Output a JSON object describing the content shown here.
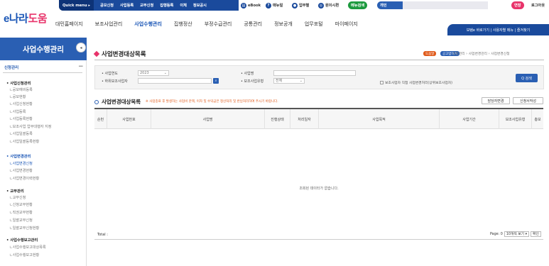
{
  "topbar": {
    "quick_menu": "Quick menu ▸",
    "quick_items": [
      "공모신청",
      "사업등록",
      "교부신청",
      "집행등록",
      "이체",
      "정보공시"
    ],
    "pills": [
      "eBook",
      "매뉴얼",
      "업무별",
      "원이시편",
      "메뉴검색",
      "개인",
      "연장",
      "로그아웃"
    ]
  },
  "logo": {
    "prefix": "e나라",
    "suffix": "도움"
  },
  "gnb": {
    "items": [
      "대민홈페이지",
      "보조사업관리",
      "사업수행관리",
      "집행정산",
      "부정수급관리",
      "공통관리",
      "정보공개",
      "업무포털",
      "마이페이지"
    ],
    "active": "사업수행관리",
    "right_links": "보탬e 바로가기 | 사용자별 메뉴 | 즐겨찾기"
  },
  "sidebar": {
    "title": "사업수행관리",
    "section": "신청관리",
    "collapse_icon": "◂",
    "groups": [
      {
        "label": "• 사업신청관리",
        "items": [
          "ㄴ공모예비등록",
          "ㄴ공모현황",
          "ㄴ사업신청현황",
          "ㄴ사업등록",
          "ㄴ사업등록현황",
          "ㄴ보조사업 업무대행자 지정",
          "ㄴ사업일괄등록",
          "ㄴ사업일괄등록현황"
        ]
      },
      {
        "label": "• 사업변경관리",
        "items": [
          "ㄴ사업변경신청",
          "ㄴ사업변경현황",
          "ㄴ사업변경이력현황"
        ]
      },
      {
        "label": "• 교부관리",
        "items": [
          "ㄴ교부신청",
          "ㄴ신청교부현황",
          "ㄴ직권교부현황",
          "ㄴ일괄교부신청",
          "ㄴ일괄교부신청현황"
        ]
      },
      {
        "label": "• 사업수행보고관리",
        "items": [
          "ㄴ사업수행보고대상목록",
          "ㄴ사업수행보고현황"
        ]
      }
    ]
  },
  "page": {
    "title": "사업변경대상목록",
    "tags": [
      "도움말",
      "공고업하기"
    ],
    "breadcrumb": "신청관리 › 사업변경관리 › 사업변경신청"
  },
  "search": {
    "year_label": "• 사업연도",
    "year_value": "2023",
    "name_label": "• 사업명",
    "name_value": "",
    "org_label": "• 하위보조사업자",
    "org_value": "",
    "type_label": "• 보조사업유형",
    "type_value": "전체",
    "checkbox_label": "보조사업자 직접 사업변경처리(상위보조사업자)",
    "search_button": "Q 검색"
  },
  "list": {
    "title": "사업변경대상목록",
    "note": "※ 사업종료 후 발생하는 사업비 잔액, 이자 및 수익금은 정산처리 및 반납처리하여 주시기 바랍니다.",
    "btn_assignee": "담당자변경",
    "btn_history": "신청서작성",
    "columns": [
      "순번",
      "사업번호",
      "사업명",
      "진행상태",
      "처리일자",
      "사업목적",
      "사업기간",
      "보조사업유형",
      "총보"
    ],
    "empty_text": "조회된 데이터가 없습니다.",
    "total_label": "Total :",
    "page_label": "Page: 0",
    "page_size": "10개씩 보기 ▾",
    "go_button": "확인"
  },
  "colors": {
    "brand_blue": "#1a4a9c",
    "accent_blue": "#2a5fb3",
    "logo_pink": "#e8336a",
    "note_orange": "#e05a1a"
  }
}
